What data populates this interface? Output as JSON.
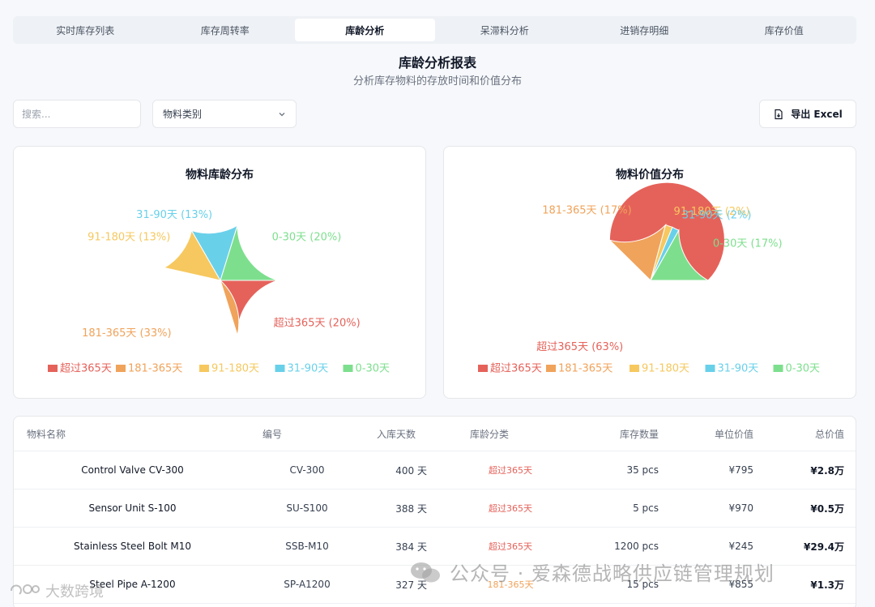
{
  "tabs": [
    {
      "label": "实时库存列表",
      "active": false
    },
    {
      "label": "库存周转率",
      "active": false
    },
    {
      "label": "库龄分析",
      "active": true
    },
    {
      "label": "呆滞料分析",
      "active": false
    },
    {
      "label": "进销存明细",
      "active": false
    },
    {
      "label": "库存价值",
      "active": false
    }
  ],
  "header": {
    "title": "库龄分析报表",
    "subtitle": "分析库存物料的存放时间和价值分布"
  },
  "toolbar": {
    "search_placeholder": "搜索...",
    "category_select": "物料类别",
    "export_label": "导出 Excel"
  },
  "colors": {
    "over365": "#e5625a",
    "d181_365": "#f0a35b",
    "d91_180": "#f6c85f",
    "d31_90": "#69d0ea",
    "d0_30": "#7ddf8e"
  },
  "chart_data": [
    {
      "type": "pie",
      "title": "物料库龄分布",
      "categories": [
        "超过365天",
        "181-365天",
        "91-180天",
        "31-90天",
        "0-30天"
      ],
      "values": [
        20,
        33,
        13,
        13,
        20
      ],
      "labels": [
        "超过365天 (20%)",
        "181-365天 (33%)",
        "91-180天 (13%)",
        "31-90天 (13%)",
        "0-30天 (20%)"
      ],
      "legend": "bottom"
    },
    {
      "type": "pie",
      "title": "物料价值分布",
      "categories": [
        "超过365天",
        "181-365天",
        "91-180天",
        "31-90天",
        "0-30天"
      ],
      "values": [
        63,
        17,
        2,
        2,
        17
      ],
      "labels": [
        "超过365天 (63%)",
        "181-365天 (17%)",
        "91-180天 (2%)",
        "31-90天 (2%)",
        "0-30天 (17%)"
      ],
      "legend": "bottom"
    }
  ],
  "table": {
    "columns": [
      "物料名称",
      "编号",
      "入库天数",
      "库龄分类",
      "库存数量",
      "单位价值",
      "总价值"
    ],
    "rows": [
      {
        "name": "Control Valve CV-300",
        "code": "CV-300",
        "days": "400 天",
        "category": "超过365天",
        "cat_color": "#e5625a",
        "qty": "35 pcs",
        "unit": "¥795",
        "total": "¥2.8万"
      },
      {
        "name": "Sensor Unit S-100",
        "code": "SU-S100",
        "days": "388 天",
        "category": "超过365天",
        "cat_color": "#e5625a",
        "qty": "5 pcs",
        "unit": "¥970",
        "total": "¥0.5万"
      },
      {
        "name": "Stainless Steel Bolt M10",
        "code": "SSB-M10",
        "days": "384 天",
        "category": "超过365天",
        "cat_color": "#e5625a",
        "qty": "1200 pcs",
        "unit": "¥245",
        "total": "¥29.4万"
      },
      {
        "name": "Steel Pipe A-1200",
        "code": "SP-A1200",
        "days": "327 天",
        "category": "181-365天",
        "cat_color": "#f0a35b",
        "qty": "15 pcs",
        "unit": "¥855",
        "total": "¥1.3万"
      }
    ]
  },
  "watermark": {
    "text": "公众号 · 爱森德战略供应链管理规划",
    "small": "大数跨境"
  }
}
